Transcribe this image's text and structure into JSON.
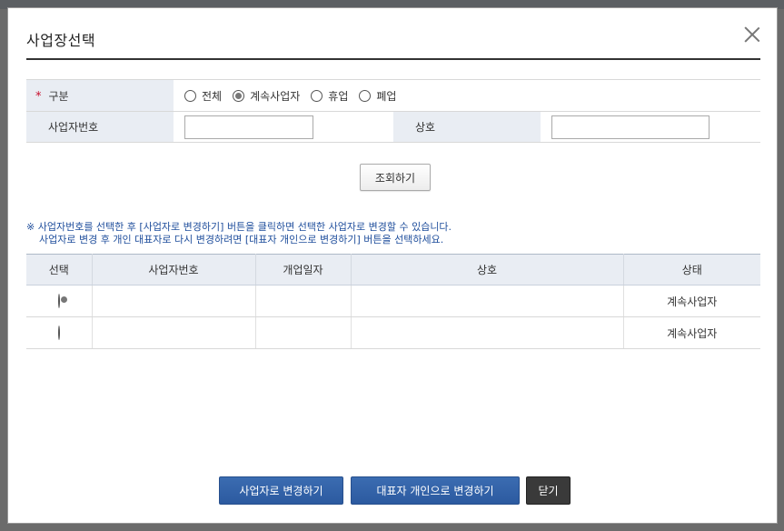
{
  "dialog": {
    "title": "사업장선택"
  },
  "form": {
    "category_label": "구분",
    "required_mark": "*",
    "options": [
      "전체",
      "계속사업자",
      "휴업",
      "폐업"
    ],
    "selected_option": "계속사업자",
    "business_number_label": "사업자번호",
    "business_number_value": "",
    "company_name_label": "상호",
    "company_name_value": ""
  },
  "search_button": "조회하기",
  "notice": {
    "line1": "※ 사업자번호를 선택한 후 [사업자로 변경하기] 버튼을 클릭하면 선택한 사업자로 변경할 수 있습니다.",
    "line2": "사업자로 변경 후 개인 대표자로 다시 변경하려면 [대표자 개인으로 변경하기] 버튼을 선택하세요."
  },
  "table": {
    "columns": [
      "선택",
      "사업자번호",
      "개업일자",
      "상호",
      "상태"
    ],
    "rows": [
      {
        "selected": true,
        "business_number": "",
        "open_date": "",
        "name": "",
        "status": "계속사업자"
      },
      {
        "selected": false,
        "business_number": "",
        "open_date": "",
        "name": "",
        "status": "계속사업자"
      }
    ]
  },
  "buttons": {
    "change_business": "사업자로 변경하기",
    "change_personal": "대표자 개인으로 변경하기",
    "close": "닫기"
  }
}
